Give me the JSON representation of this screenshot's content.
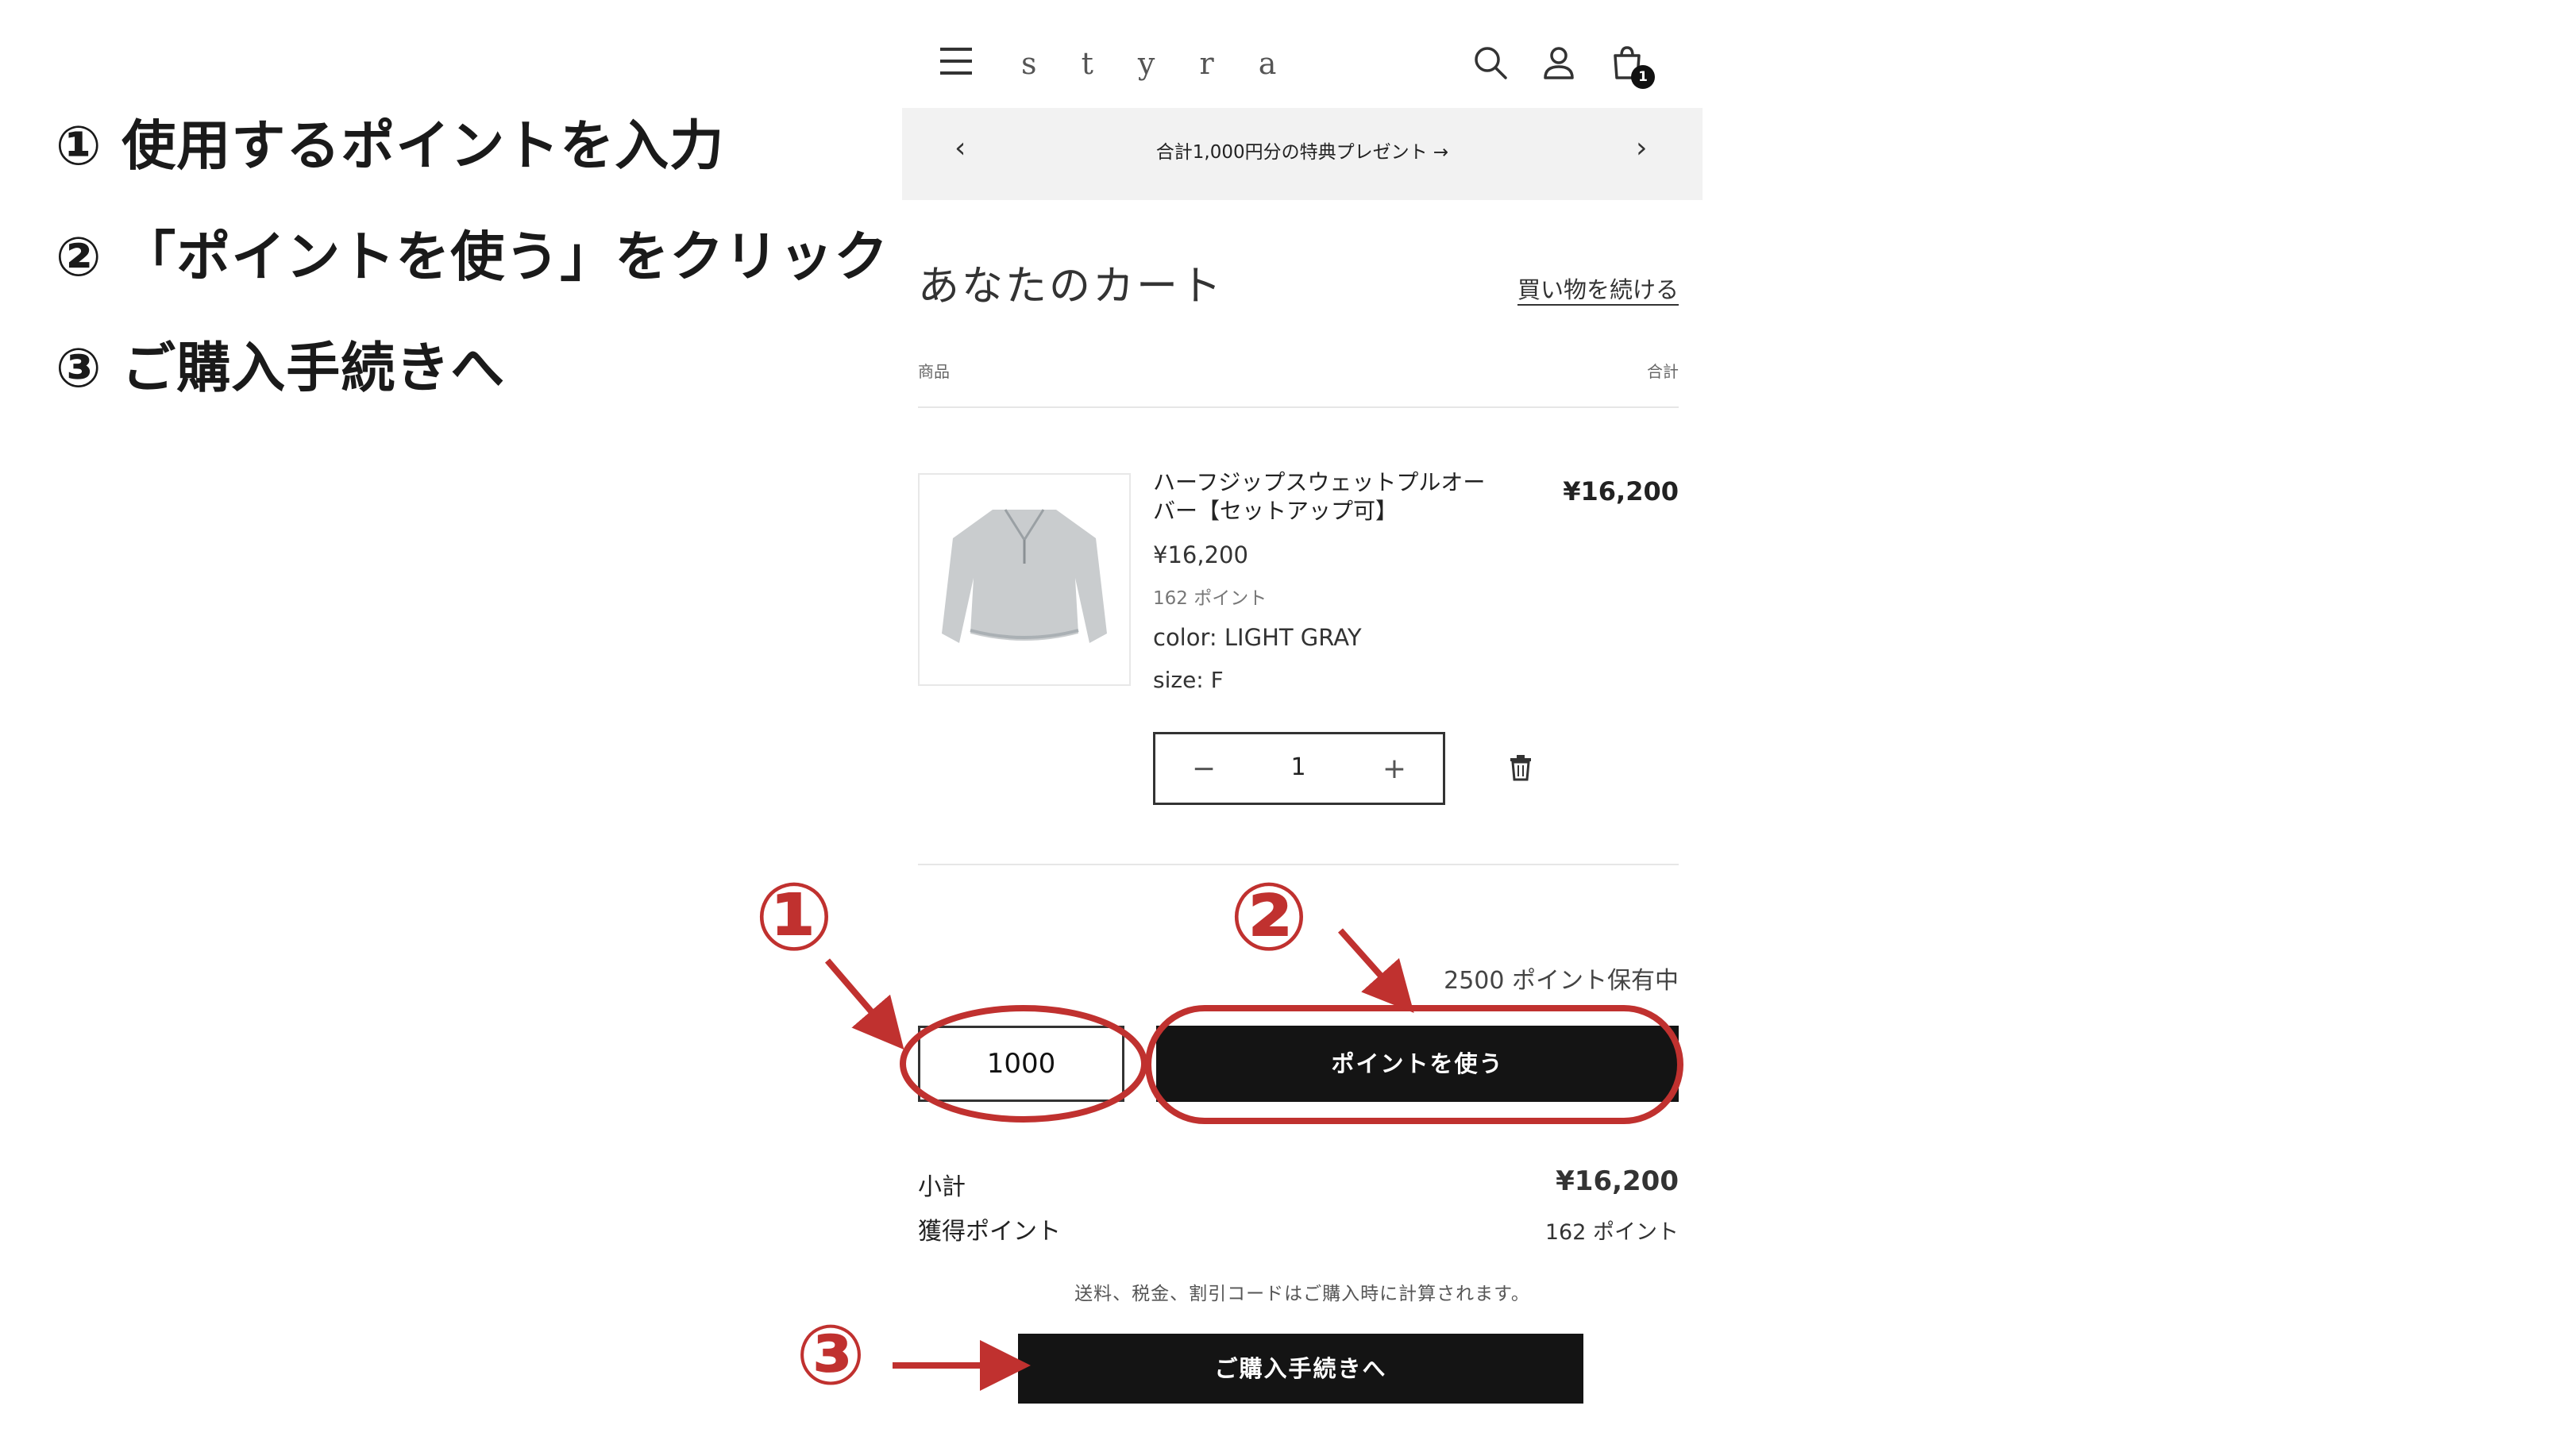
{
  "instructions": [
    "① 使用するポイントを入力",
    "② 「ポイントを使う」をクリック",
    "③ ご購入手続きへ"
  ],
  "header": {
    "logo": "s t y r a",
    "cart_count": "1"
  },
  "banner": {
    "text": "合計1,000円分の特典プレゼント →",
    "prev": "‹",
    "next": "›"
  },
  "cart": {
    "title": "あなたのカート",
    "continue_shopping": "買い物を続ける",
    "col_product": "商品",
    "col_total": "合計"
  },
  "item": {
    "name": "ハーフジップスウェットプルオーバー【セットアップ可】",
    "price": "¥16,200",
    "points": "162 ポイント",
    "color": "color: LIGHT GRAY",
    "size": "size: F",
    "quantity": "1",
    "line_total": "¥16,200",
    "minus": "−",
    "plus": "+"
  },
  "points": {
    "held": "2500 ポイント保有中",
    "input_value": "1000",
    "use_button": "ポイントを使う"
  },
  "summary": {
    "subtotal_label": "小計",
    "subtotal_value": "¥16,200",
    "earned_label": "獲得ポイント",
    "earned_value": "162 ポイント",
    "tax_note": "送料、税金、割引コードはご購入時に計算されます。",
    "checkout_button": "ご購入手続きへ"
  },
  "markers": [
    "①",
    "②",
    "③"
  ],
  "colors": {
    "annotation": "#c0312f",
    "button": "#141414",
    "banner_bg": "#f2f2f2"
  }
}
